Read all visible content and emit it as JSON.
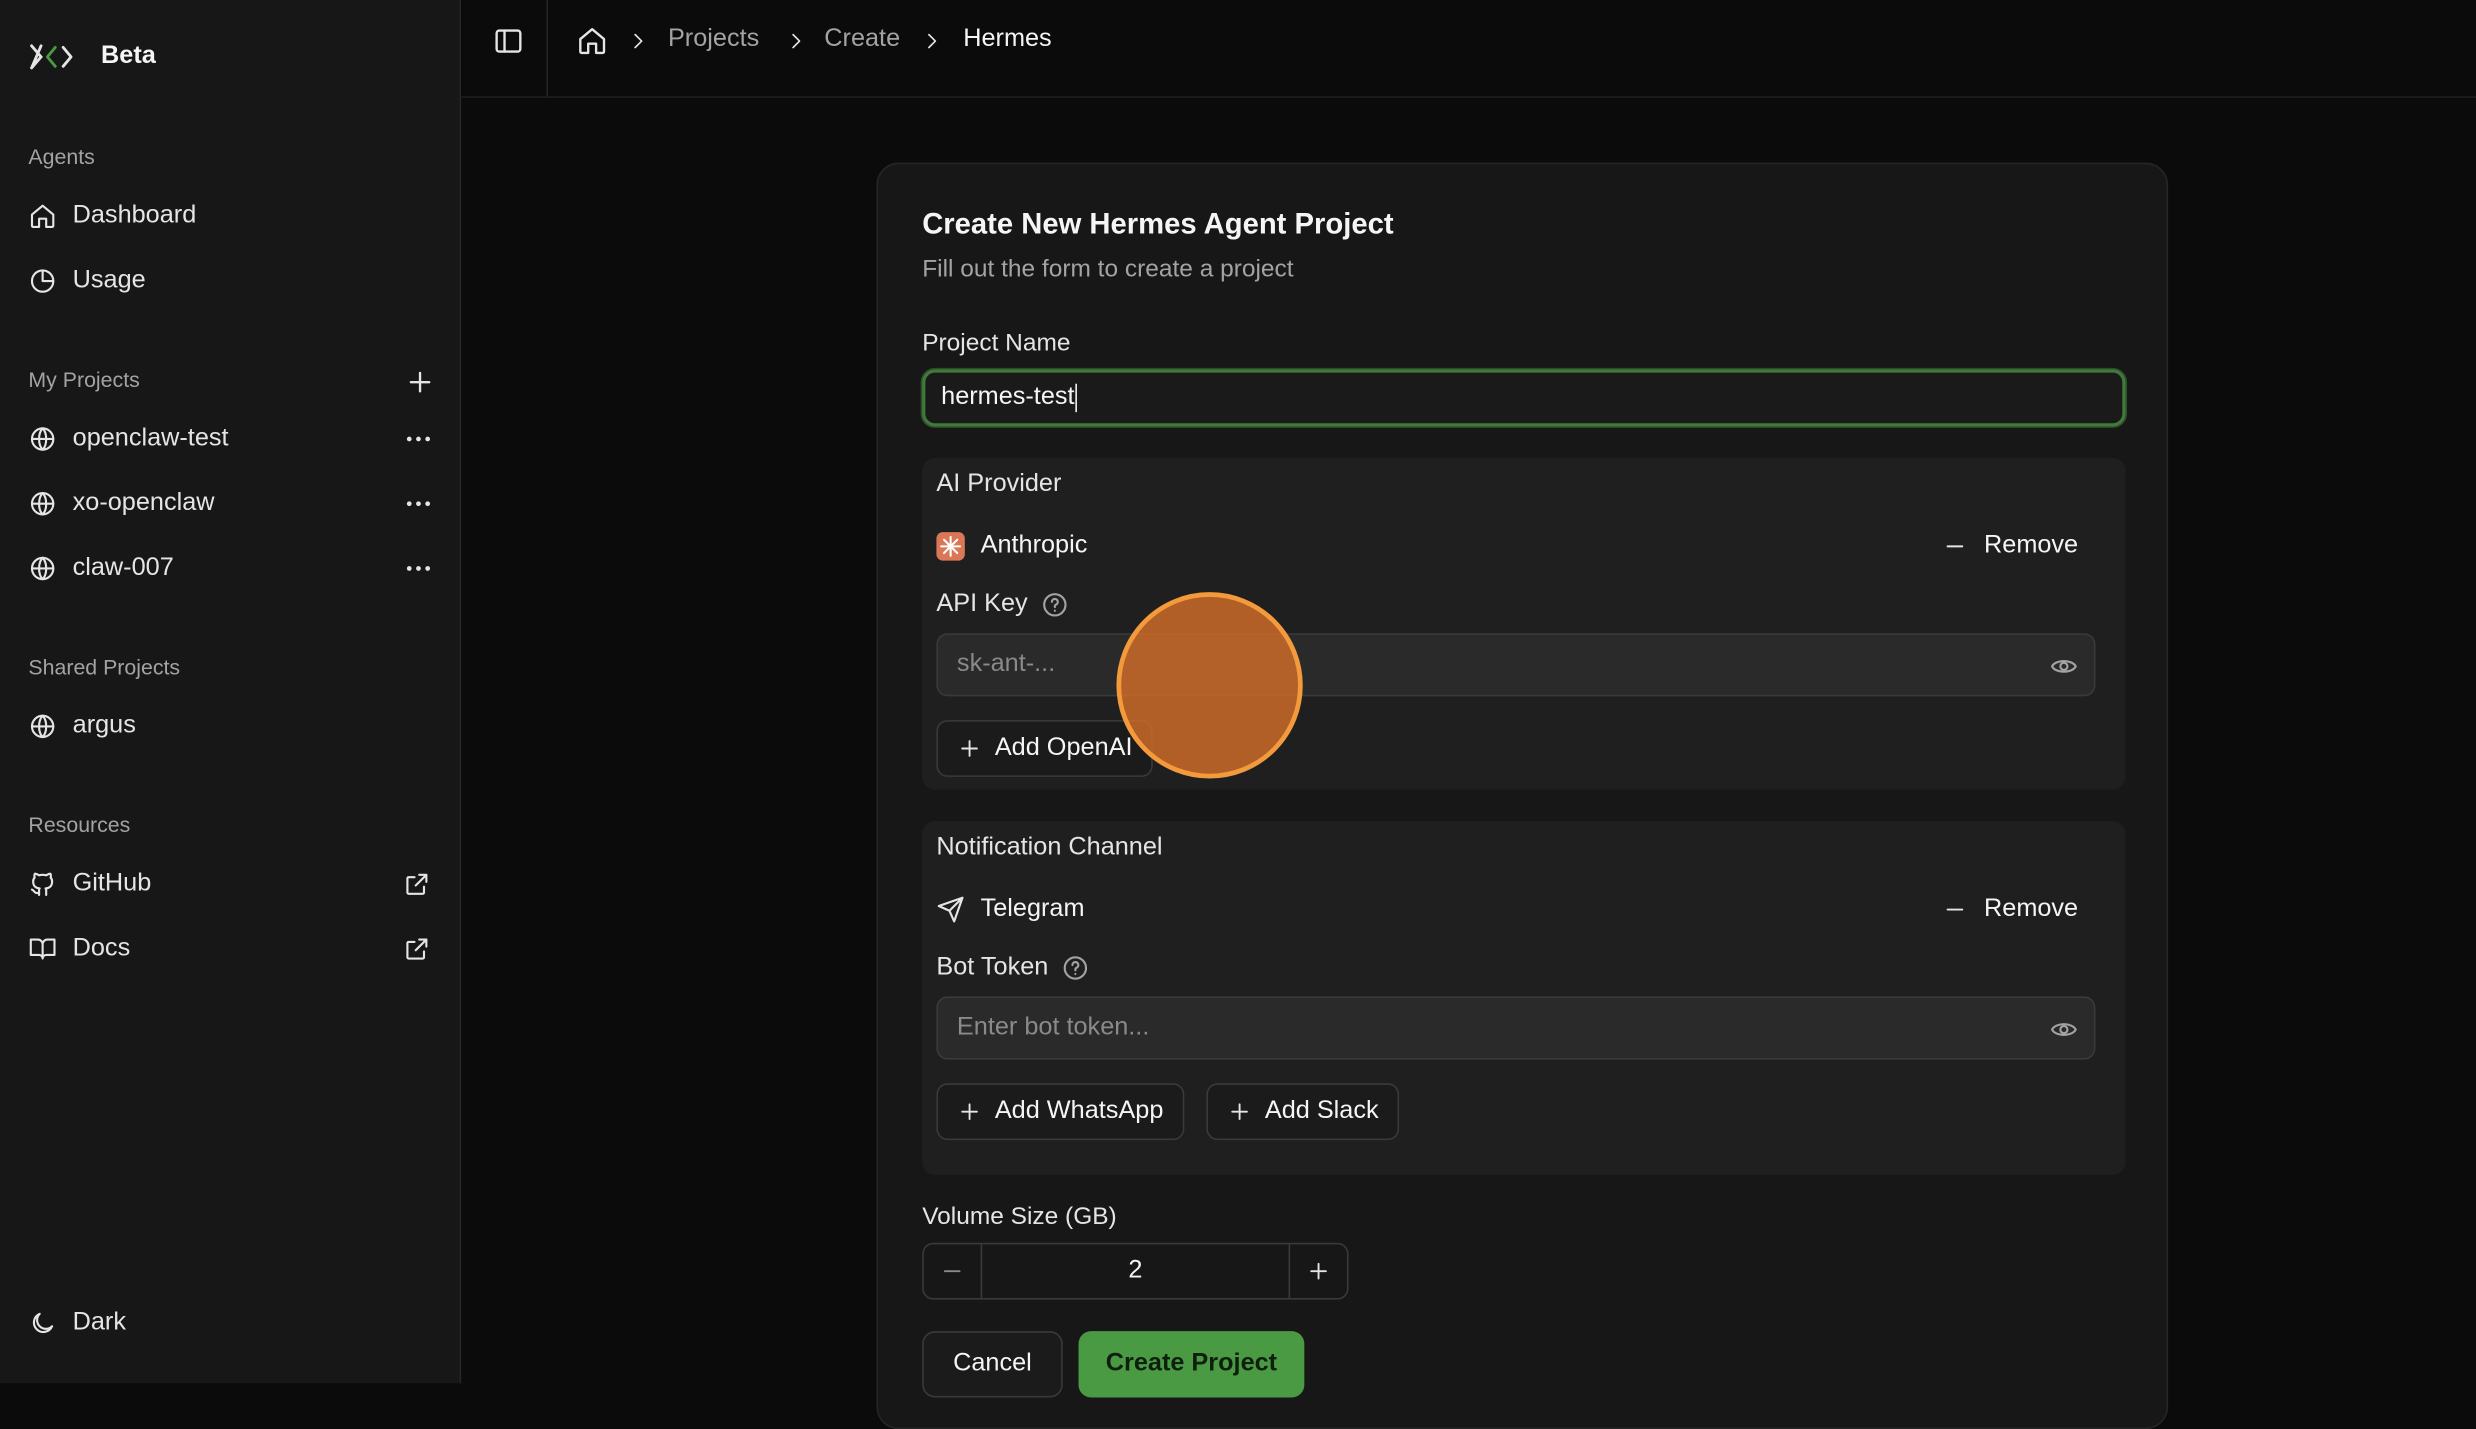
{
  "brand": {
    "name": "Beta"
  },
  "sidebar": {
    "agents_label": "Agents",
    "agents": [
      {
        "label": "Dashboard",
        "icon": "home-icon"
      },
      {
        "label": "Usage",
        "icon": "pie-chart-icon"
      }
    ],
    "my_projects_label": "My Projects",
    "my_projects": [
      {
        "label": "openclaw-test",
        "icon": "globe-icon"
      },
      {
        "label": "xo-openclaw",
        "icon": "globe-icon"
      },
      {
        "label": "claw-007",
        "icon": "globe-icon"
      }
    ],
    "shared_projects_label": "Shared Projects",
    "shared_projects": [
      {
        "label": "argus",
        "icon": "globe-icon"
      }
    ],
    "resources_label": "Resources",
    "resources": [
      {
        "label": "GitHub",
        "icon": "github-icon"
      },
      {
        "label": "Docs",
        "icon": "book-icon"
      }
    ],
    "theme_label": "Dark"
  },
  "breadcrumb": [
    "Projects",
    "Create",
    "Hermes"
  ],
  "form": {
    "title": "Create New Hermes Agent Project",
    "subtitle": "Fill out the form to create a project",
    "project_name_label": "Project Name",
    "project_name_value": "hermes-test",
    "ai_provider": {
      "title": "AI Provider",
      "provider": "Anthropic",
      "remove_label": "Remove",
      "key_label": "API Key",
      "key_placeholder": "sk-ant-...",
      "add_label": "Add OpenAI"
    },
    "notification": {
      "title": "Notification Channel",
      "channel": "Telegram",
      "remove_label": "Remove",
      "token_label": "Bot Token",
      "token_placeholder": "Enter bot token...",
      "add_whatsapp": "Add WhatsApp",
      "add_slack": "Add Slack"
    },
    "volume_label": "Volume Size (GB)",
    "volume_value": "2",
    "cancel_label": "Cancel",
    "create_label": "Create Project"
  },
  "colors": {
    "accent": "#4a9a44",
    "focus_ring": "#3f7a3a",
    "anthropic": "#d97757",
    "cursor": "#f29a3c"
  }
}
